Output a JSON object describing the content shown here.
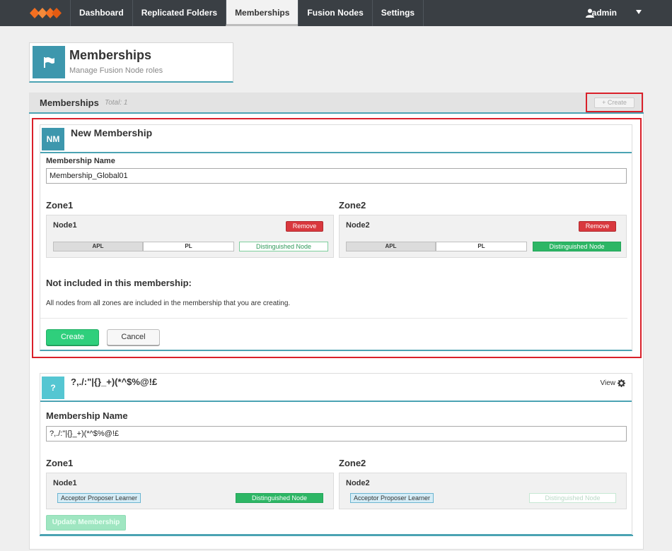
{
  "nav": {
    "items": [
      "Dashboard",
      "Replicated Folders",
      "Memberships",
      "Fusion Nodes",
      "Settings"
    ],
    "active_index": 2,
    "user": "admin"
  },
  "header": {
    "title": "Memberships",
    "subtitle": "Manage Fusion Node roles"
  },
  "list": {
    "title": "Memberships",
    "total": "Total: 1",
    "create_label": "+ Create"
  },
  "new_membership": {
    "badge": "NM",
    "title": "New Membership",
    "name_label": "Membership Name",
    "name_value": "Membership_Global01",
    "zones": [
      {
        "name": "Zone1",
        "node": "Node1",
        "remove": "Remove",
        "apl": "APL",
        "pl": "PL",
        "dn": "Distinguished Node"
      },
      {
        "name": "Zone2",
        "node": "Node2",
        "remove": "Remove",
        "apl": "APL",
        "pl": "PL",
        "dn": "Distinguished Node"
      }
    ],
    "not_included_title": "Not included in this membership:",
    "not_included_text": "All nodes from all zones are included in the membership that you are creating.",
    "create_label": "Create",
    "cancel_label": "Cancel"
  },
  "existing_membership": {
    "badge": "?",
    "title": "?,./:\"|{}_+)(*^$%@!£",
    "view_label": "View",
    "name_label": "Membership Name",
    "name_value": "?,./:\"|{}_+)(*^$%@!£",
    "zones": [
      {
        "name": "Zone1",
        "node": "Node1",
        "role": "Acceptor Proposer Learner",
        "dn": "Distinguished Node"
      },
      {
        "name": "Zone2",
        "node": "Node2",
        "role": "Acceptor Proposer Learner",
        "dn": "Distinguished Node"
      }
    ],
    "update_label": "Update Membership"
  },
  "colors": {
    "accent": "#3d97ad",
    "danger": "#d9383e",
    "success": "#2db665",
    "highlight": "#d9202a",
    "nav_bg": "#3a3f44"
  }
}
